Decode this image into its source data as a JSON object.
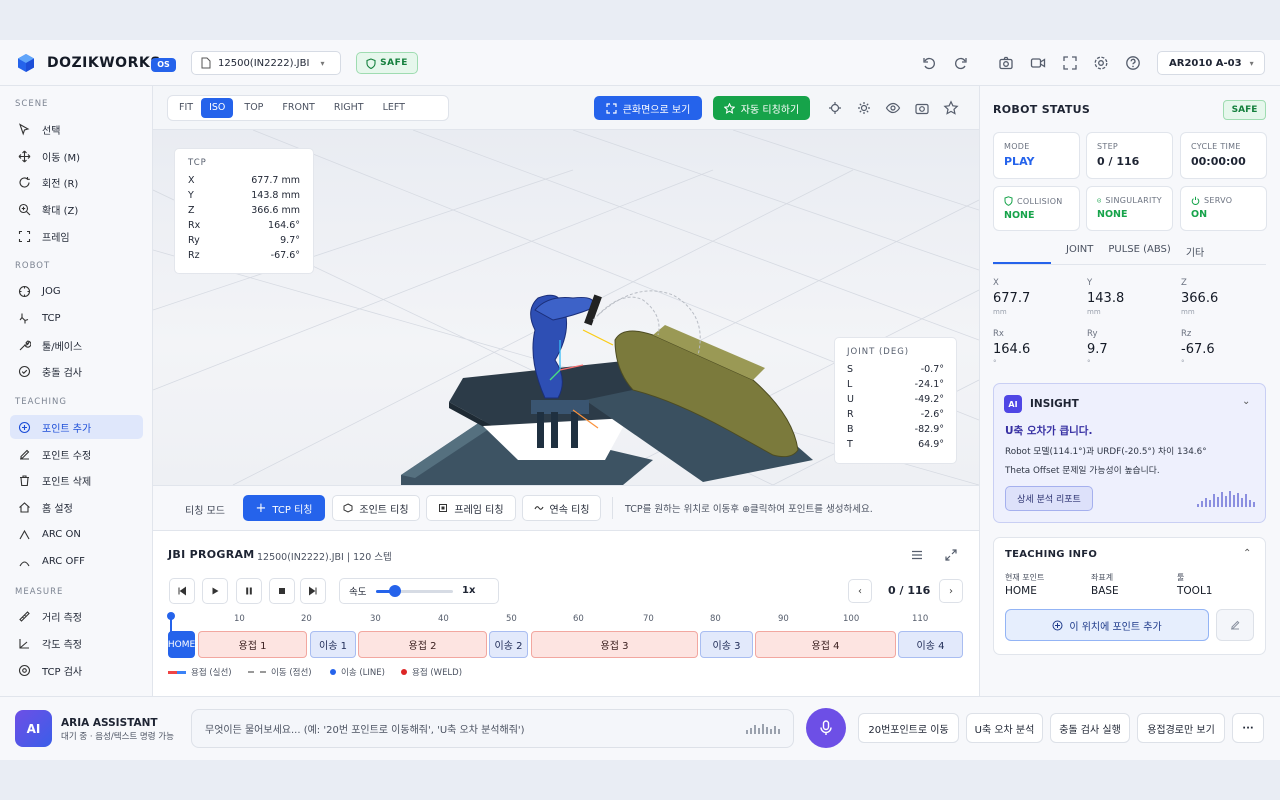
{
  "header": {
    "brand": "DOZIKWORKS",
    "brand_badge": "OS",
    "file_name": "12500(IN2222).JBI",
    "safety_status": "SAFE",
    "robot_selector": "AR2010 A-03",
    "icons": [
      "undo-icon",
      "redo-icon",
      "camera-icon",
      "video-icon",
      "fullscreen-icon",
      "settings-icon",
      "help-icon"
    ]
  },
  "sidebar": {
    "scene_title": "SCENE",
    "scene": [
      {
        "label": "선택",
        "icon": "cursor-icon"
      },
      {
        "label": "이동 (M)",
        "icon": "move-icon"
      },
      {
        "label": "회전 (R)",
        "icon": "rotate-icon"
      },
      {
        "label": "확대 (Z)",
        "icon": "zoom-icon"
      },
      {
        "label": "프레임",
        "icon": "frame-icon"
      }
    ],
    "robot_title": "ROBOT",
    "robot": [
      {
        "label": "JOG",
        "icon": "jog-icon"
      },
      {
        "label": "TCP",
        "icon": "tcp-icon"
      },
      {
        "label": "툴/베이스",
        "icon": "wrench-icon"
      },
      {
        "label": "충돌 검사",
        "icon": "check-shield-icon"
      }
    ],
    "teaching_title": "TEACHING",
    "teaching": [
      {
        "label": "포인트 추가",
        "icon": "plus-circle-icon",
        "active": true
      },
      {
        "label": "포인트 수정",
        "icon": "edit-icon"
      },
      {
        "label": "포인트 삭제",
        "icon": "trash-icon"
      },
      {
        "label": "홈 설정",
        "icon": "home-icon"
      },
      {
        "label": "ARC ON",
        "icon": "arc-on-icon"
      },
      {
        "label": "ARC OFF",
        "icon": "arc-off-icon"
      }
    ],
    "measure_title": "MEASURE",
    "measure": [
      {
        "label": "거리 측정",
        "icon": "ruler-icon"
      },
      {
        "label": "각도 측정",
        "icon": "angle-icon"
      },
      {
        "label": "TCP 검사",
        "icon": "target-icon"
      }
    ]
  },
  "viewport": {
    "views": [
      "FIT",
      "ISO",
      "TOP",
      "FRONT",
      "RIGHT",
      "LEFT"
    ],
    "active_view": "ISO",
    "big_view_label": "큰화면으로 보기",
    "auto_teach_label": "자동 티칭하기",
    "tcp": {
      "title": "TCP",
      "rows": [
        [
          "X",
          "677.7 mm"
        ],
        [
          "Y",
          "143.8 mm"
        ],
        [
          "Z",
          "366.6 mm"
        ],
        [
          "Rx",
          "164.6°"
        ],
        [
          "Ry",
          "9.7°"
        ],
        [
          "Rz",
          "-67.6°"
        ]
      ]
    },
    "joint": {
      "title": "JOINT (DEG)",
      "rows": [
        [
          "S",
          "-0.7°"
        ],
        [
          "L",
          "-24.1°"
        ],
        [
          "U",
          "-49.2°"
        ],
        [
          "R",
          "-2.6°"
        ],
        [
          "B",
          "-82.9°"
        ],
        [
          "T",
          "64.9°"
        ]
      ]
    }
  },
  "teach_mode": {
    "label": "티칭 모드",
    "buttons": [
      "TCP 티칭",
      "조인트 티칭",
      "프레임 티칭",
      "연속 티칭"
    ],
    "hint": "TCP를 원하는 위치로 이동후 ⊕클릭하여 포인트를 생성하세요."
  },
  "program": {
    "title": "JBI PROGRAM",
    "subtitle": "12500(IN2222).JBI | 120 스텝",
    "speed_label": "속도",
    "speed_value": "1x",
    "speed_fraction": 0.25,
    "counter": "0 / 116",
    "ticks": [
      "10",
      "20",
      "30",
      "40",
      "50",
      "60",
      "70",
      "80",
      "90",
      "100",
      "110"
    ],
    "segments": [
      {
        "label": "HOME",
        "type": "home"
      },
      {
        "label": "용접 1",
        "type": "weld"
      },
      {
        "label": "이송 1",
        "type": "move"
      },
      {
        "label": "용접 2",
        "type": "weld"
      },
      {
        "label": "이송 2",
        "type": "move"
      },
      {
        "label": "용접 3",
        "type": "weld"
      },
      {
        "label": "이송 3",
        "type": "move"
      },
      {
        "label": "용접 4",
        "type": "weld"
      },
      {
        "label": "이송 4",
        "type": "move"
      }
    ],
    "legend": [
      "용접 (실선)",
      "이동 (점선)",
      "이송 (LINE)",
      "용접 (WELD)"
    ]
  },
  "status": {
    "title": "ROBOT STATUS",
    "safe": "SAFE",
    "cards": [
      {
        "label": "MODE",
        "value": "PLAY"
      },
      {
        "label": "STEP",
        "value": "0 / 116"
      },
      {
        "label": "CYCLE TIME",
        "value": "00:00:00"
      },
      {
        "label": "COLLISION",
        "value": "NONE"
      },
      {
        "label": "SINGULARITY",
        "value": "NONE"
      },
      {
        "label": "SERVO",
        "value": "ON"
      }
    ],
    "tabs": [
      "",
      "JOINT",
      "PULSE (ABS)",
      "기타"
    ],
    "coords": [
      {
        "label": "X",
        "value": "677.7",
        "unit": "mm"
      },
      {
        "label": "Y",
        "value": "143.8",
        "unit": "mm"
      },
      {
        "label": "Z",
        "value": "366.6",
        "unit": "mm"
      },
      {
        "label": "Rx",
        "value": "164.6",
        "unit": "°"
      },
      {
        "label": "Ry",
        "value": "9.7",
        "unit": "°"
      },
      {
        "label": "Rz",
        "value": "-67.6",
        "unit": "°"
      }
    ]
  },
  "insight": {
    "badge": "AI",
    "title": "INSIGHT",
    "headline": "U축 오차가 큽니다.",
    "line1": "Robot 모델(114.1°)과 URDF(-20.5°) 차이 134.6°",
    "line2": "Theta Offset 문제일 가능성이 높습니다.",
    "button": "상세 분석 리포트"
  },
  "teaching_info": {
    "title": "TEACHING INFO",
    "fields": [
      {
        "label": "현재 포인트",
        "value": "HOME"
      },
      {
        "label": "좌표계",
        "value": "BASE"
      },
      {
        "label": "툴",
        "value": "TOOL1"
      }
    ],
    "add_button": "이 위치에 포인트 추가"
  },
  "assistant": {
    "badge": "AI",
    "name": "ARIA ASSISTANT",
    "status": "대기 중 · 음성/텍스트 명령 가능",
    "placeholder": "무엇이든 물어보세요... (예: '20번 포인트로 이동해줘', 'U축 오차 분석해줘')",
    "quick": [
      "20번포인트로 이동",
      "U축 오차 분석",
      "충돌 검사 실행",
      "용접경로만 보기"
    ],
    "more": "···"
  }
}
